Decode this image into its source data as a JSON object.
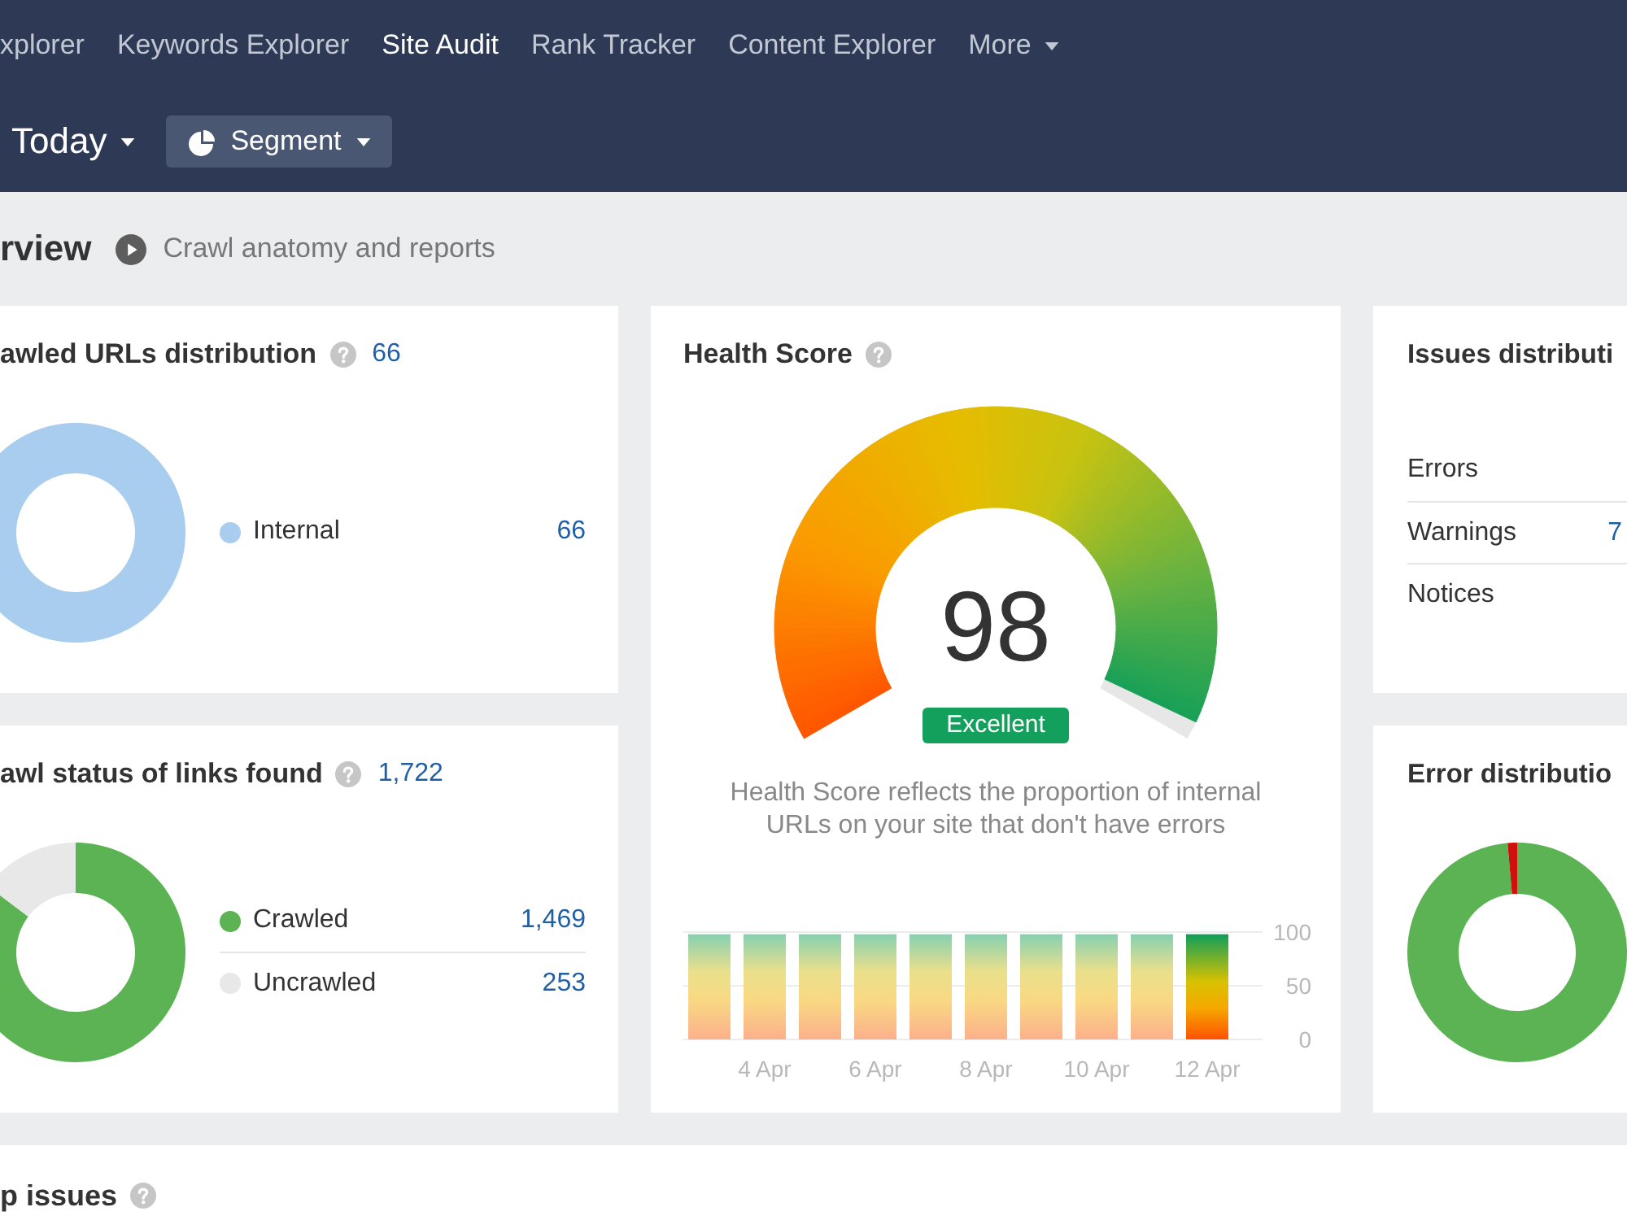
{
  "nav": {
    "links": [
      {
        "label": "xplorer",
        "kind": "link",
        "selected": false
      },
      {
        "label": "Keywords Explorer",
        "kind": "link",
        "selected": false
      },
      {
        "label": "Site Audit",
        "kind": "link",
        "selected": true
      },
      {
        "label": "Rank Tracker",
        "kind": "link",
        "selected": false
      },
      {
        "label": "Content Explorer",
        "kind": "link",
        "selected": false
      },
      {
        "label": "More",
        "kind": "menu",
        "selected": false
      }
    ]
  },
  "toolbar": {
    "date": "Today",
    "segment": "Segment"
  },
  "overview": {
    "title": "rview",
    "video_link": "Crawl anatomy and reports"
  },
  "crawled_urls": {
    "title": "awled URLs distribution",
    "total": "66",
    "legend": [
      {
        "label": "Internal",
        "value": "66",
        "color": "#a8cdee"
      }
    ]
  },
  "health_score": {
    "title": "Health Score",
    "score": "98",
    "level": 0.98,
    "rating": "Excellent",
    "description": "Health Score reflects the proportion of internal URLs on your site that don't have errors",
    "chart_data": {
      "type": "bar",
      "categories": [
        null,
        "4 Apr",
        null,
        "6 Apr",
        null,
        "8 Apr",
        null,
        "10 Apr",
        null,
        "12 Apr"
      ],
      "values": [
        98,
        98,
        98,
        98,
        98,
        98,
        98,
        98,
        98,
        98
      ],
      "ylim": [
        0,
        100
      ],
      "yticks": [
        0,
        50,
        100
      ]
    }
  },
  "issues_distribution": {
    "title": "Issues distributi",
    "rows": [
      {
        "label": "Errors"
      },
      {
        "label": "Warnings",
        "value": "7"
      },
      {
        "label": "Notices"
      }
    ]
  },
  "crawl_status": {
    "title": "awl status of links found",
    "total": "1,722",
    "legend": [
      {
        "label": "Crawled",
        "value": "1,469",
        "color": "#5cb354"
      },
      {
        "label": "Uncrawled",
        "value": "253",
        "color": "#e8e8e8"
      }
    ],
    "chart_data": {
      "type": "donut",
      "values": [
        85.3,
        14.7
      ]
    }
  },
  "error_distribution": {
    "title": "Error distributio"
  },
  "top_issues": {
    "title": "p issues"
  }
}
